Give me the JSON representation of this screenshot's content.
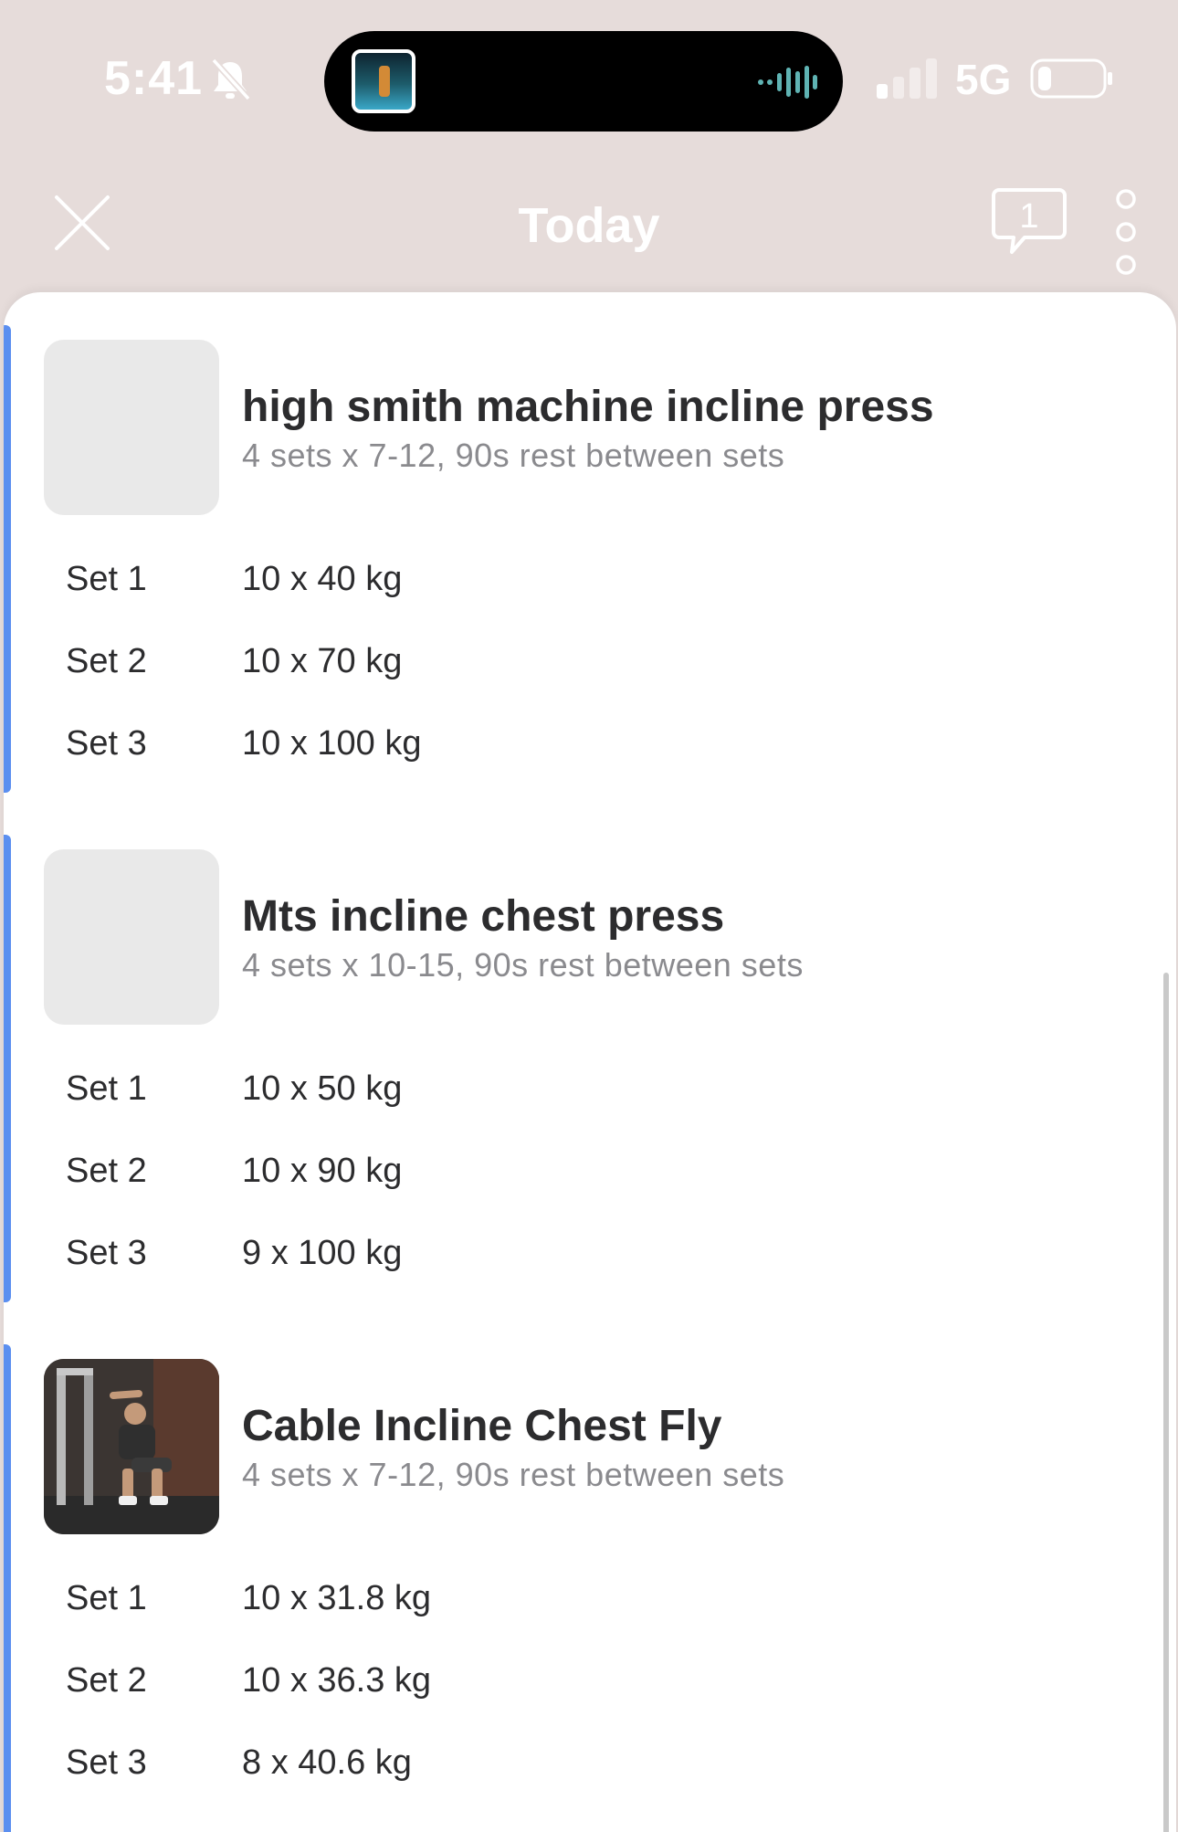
{
  "status": {
    "time": "5:41",
    "network": "5G"
  },
  "nav": {
    "title": "Today",
    "comment_count": "1"
  },
  "exercises": [
    {
      "name": "high smith machine incline press",
      "desc": "4 sets x 7-12, 90s rest between sets",
      "sets": [
        {
          "label": "Set 1",
          "value": "10 x 40 kg"
        },
        {
          "label": "Set 2",
          "value": "10 x 70 kg"
        },
        {
          "label": "Set 3",
          "value": "10 x 100 kg"
        }
      ]
    },
    {
      "name": "Mts incline chest press",
      "desc": "4 sets x 10-15, 90s rest between sets",
      "sets": [
        {
          "label": "Set 1",
          "value": "10 x 50 kg"
        },
        {
          "label": "Set 2",
          "value": "10 x 90 kg"
        },
        {
          "label": "Set 3",
          "value": "9 x 100 kg"
        }
      ]
    },
    {
      "name": "Cable Incline Chest Fly",
      "desc": "4 sets x 7-12, 90s rest between sets",
      "sets": [
        {
          "label": "Set 1",
          "value": "10 x 31.8 kg"
        },
        {
          "label": "Set 2",
          "value": "10 x 36.3 kg"
        },
        {
          "label": "Set 3",
          "value": "8 x 40.6 kg"
        }
      ]
    }
  ],
  "colors": {
    "accent_bar": "#5b8ff0",
    "header_bg": "#e6dcda"
  }
}
